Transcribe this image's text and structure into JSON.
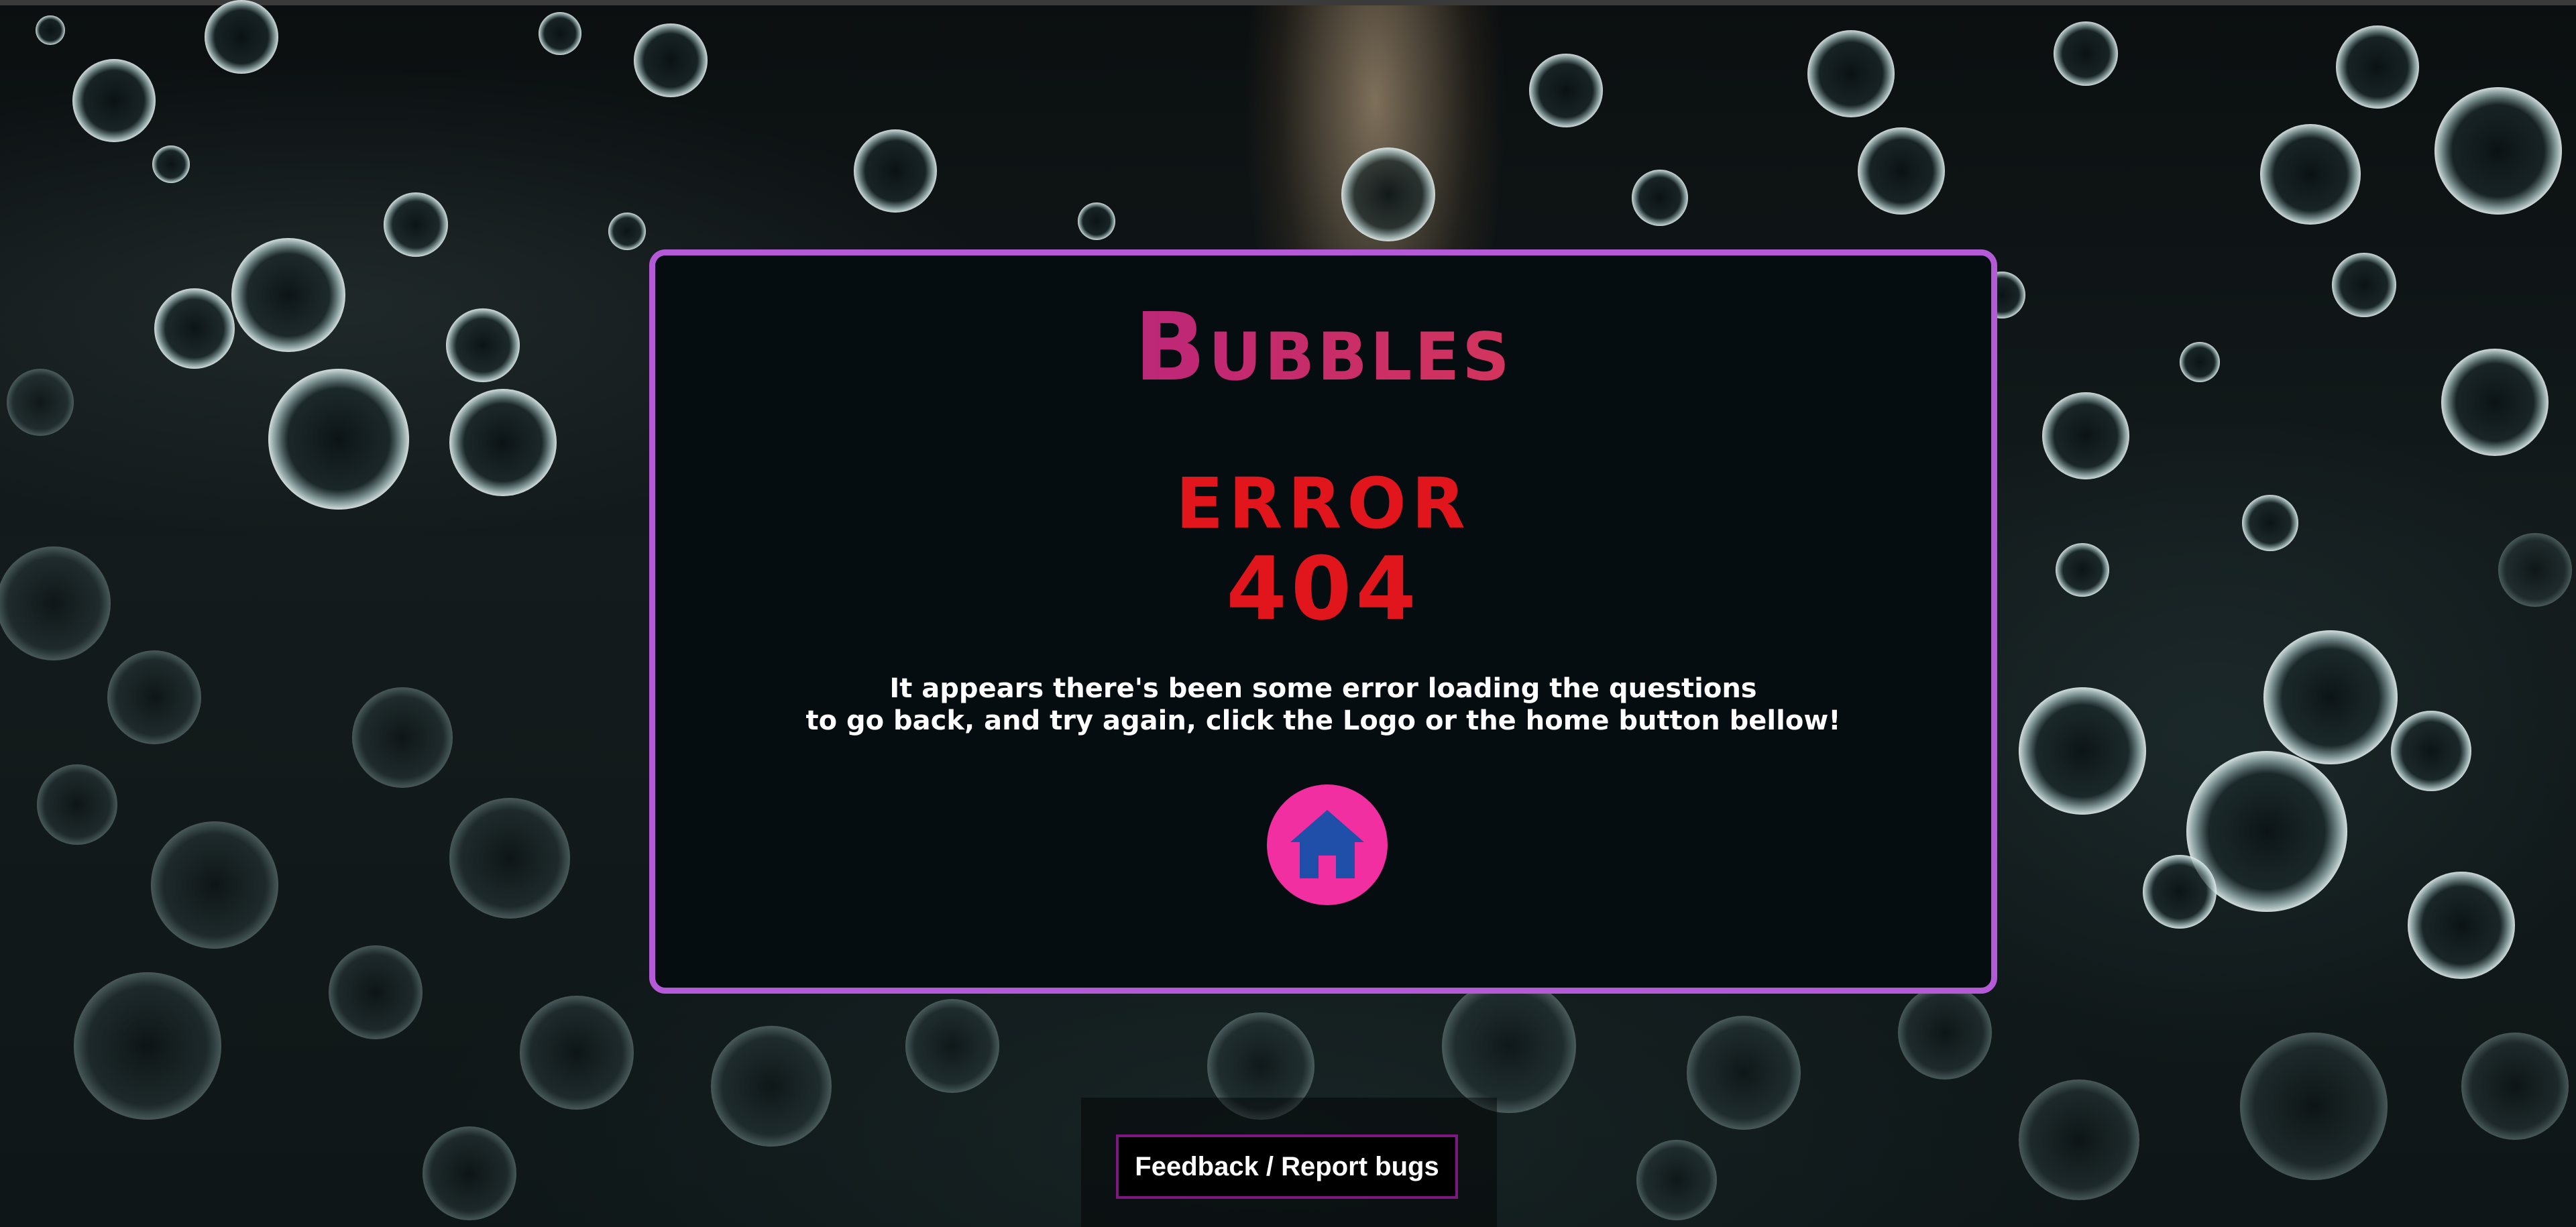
{
  "logo": {
    "text": "Bubbles"
  },
  "error": {
    "word": "ERROR",
    "code": "404",
    "message_line1": "It appears there's been some error loading the questions",
    "message_line2": "to go back, and try again, click the Logo or the home button bellow!"
  },
  "home_button": {
    "icon": "home-icon"
  },
  "footer": {
    "feedback_label": "Feedback / Report bugs"
  },
  "colors": {
    "card_border": "#b45ad6",
    "card_background": "#050d11",
    "error_red": "#e0161c",
    "home_button": "#f22fa0",
    "home_icon": "#1f4fa8",
    "feedback_border": "#7e1780"
  }
}
